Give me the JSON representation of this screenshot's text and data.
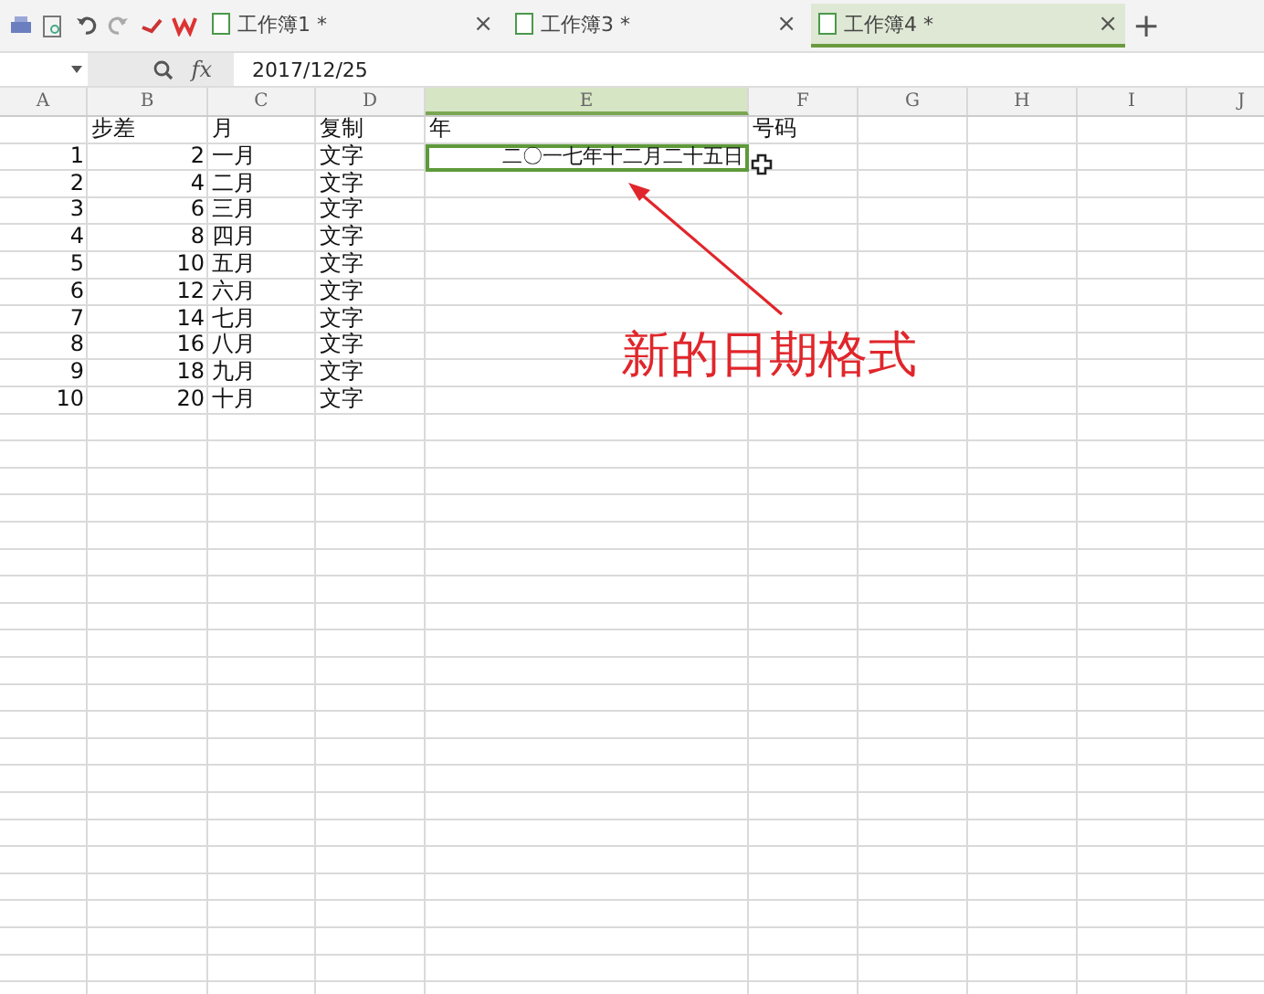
{
  "toolbar": {
    "tabs": [
      {
        "label": "工作簿1 *",
        "close": "×",
        "selected": false
      },
      {
        "label": "工作簿3 *",
        "close": "×",
        "selected": false
      },
      {
        "label": "工作簿4 *",
        "close": "×",
        "selected": true
      }
    ],
    "new_tab": "+"
  },
  "formula_bar": {
    "fx": "fx",
    "value": "2017/12/25"
  },
  "sheet": {
    "columns": [
      {
        "label": "A",
        "selected": false
      },
      {
        "label": "B",
        "selected": false
      },
      {
        "label": "C",
        "selected": false
      },
      {
        "label": "D",
        "selected": false
      },
      {
        "label": "E",
        "selected": true
      },
      {
        "label": "F",
        "selected": false
      },
      {
        "label": "G",
        "selected": false
      },
      {
        "label": "H",
        "selected": false
      },
      {
        "label": "I",
        "selected": false
      },
      {
        "label": "J",
        "selected": false
      }
    ],
    "rows": [
      {
        "cells": [
          "",
          "步差",
          "月",
          "复制",
          "年",
          "号码"
        ]
      },
      {
        "cells": [
          "1",
          "2",
          "一月",
          "文字",
          {
            "text": "二〇一七年十二月二十五日",
            "kind": "date",
            "selected": true
          }
        ]
      },
      {
        "cells": [
          "2",
          "4",
          "二月",
          "文字"
        ]
      },
      {
        "cells": [
          "3",
          "6",
          "三月",
          "文字"
        ]
      },
      {
        "cells": [
          "4",
          "8",
          "四月",
          "文字"
        ]
      },
      {
        "cells": [
          "5",
          "10",
          "五月",
          "文字"
        ]
      },
      {
        "cells": [
          "6",
          "12",
          "六月",
          "文字"
        ]
      },
      {
        "cells": [
          "7",
          "14",
          "七月",
          "文字"
        ]
      },
      {
        "cells": [
          "8",
          "16",
          "八月",
          "文字"
        ]
      },
      {
        "cells": [
          "9",
          "18",
          "九月",
          "文字"
        ]
      },
      {
        "cells": [
          "10",
          "20",
          "十月",
          "文字"
        ]
      }
    ]
  },
  "annotation": {
    "text": "新的日期格式"
  }
}
